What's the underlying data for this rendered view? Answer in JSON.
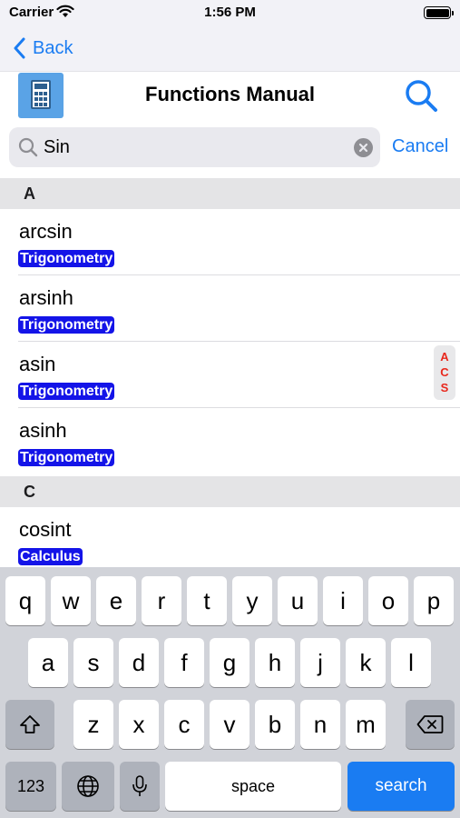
{
  "status": {
    "carrier": "Carrier",
    "time": "1:56 PM",
    "battery_level": 1.0
  },
  "nav": {
    "back_label": "Back"
  },
  "header": {
    "title": "Functions Manual"
  },
  "search": {
    "value": "Sin",
    "cancel_label": "Cancel"
  },
  "sections": [
    {
      "letter": "A",
      "items": [
        {
          "name": "arcsin",
          "category": "Trigonometry"
        },
        {
          "name": "arsinh",
          "category": "Trigonometry"
        },
        {
          "name": "asin",
          "category": "Trigonometry"
        },
        {
          "name": "asinh",
          "category": "Trigonometry"
        }
      ]
    },
    {
      "letter": "C",
      "items": [
        {
          "name": "cosint",
          "category": "Calculus"
        }
      ]
    }
  ],
  "index": [
    "A",
    "C",
    "S"
  ],
  "keyboard": {
    "row1": [
      "q",
      "w",
      "e",
      "r",
      "t",
      "y",
      "u",
      "i",
      "o",
      "p"
    ],
    "row2": [
      "a",
      "s",
      "d",
      "f",
      "g",
      "h",
      "j",
      "k",
      "l"
    ],
    "row3": [
      "z",
      "x",
      "c",
      "v",
      "b",
      "n",
      "m"
    ],
    "numbers_label": "123",
    "space_label": "space",
    "search_label": "search"
  },
  "colors": {
    "accent": "#1a7cf2",
    "badge": "#1414e8",
    "index": "#e8271c"
  }
}
